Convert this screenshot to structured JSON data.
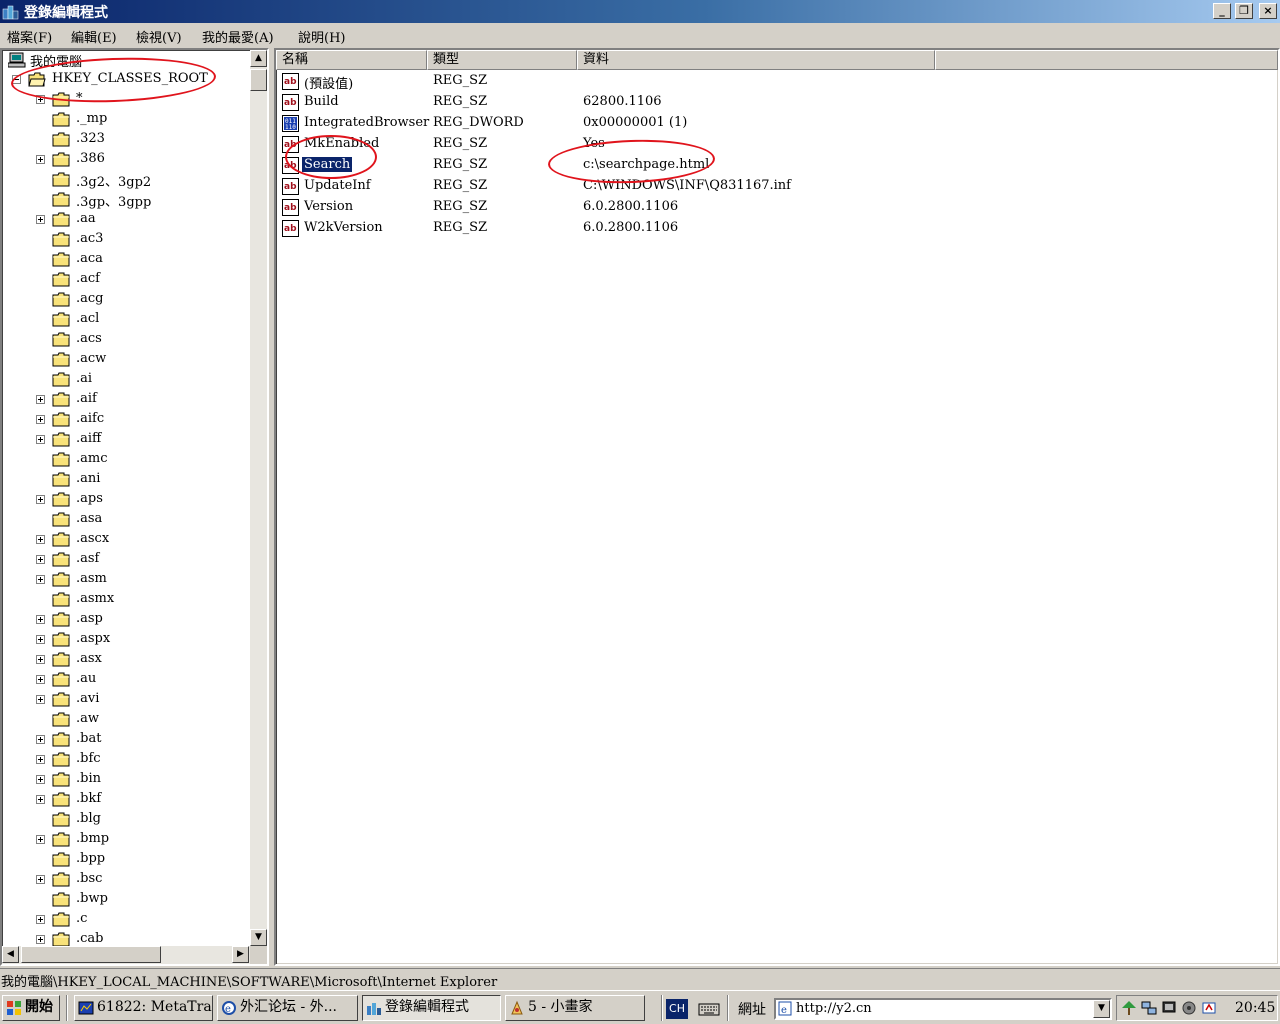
{
  "window": {
    "title": "登錄編輯程式"
  },
  "caption_buttons": {
    "minimize": "_",
    "restore": "❐",
    "close": "×"
  },
  "menu": {
    "file": "檔案(F)",
    "edit": "編輯(E)",
    "view": "檢視(V)",
    "favorites": "我的最愛(A)",
    "help": "說明(H)"
  },
  "tree": {
    "root": "我的電腦",
    "hive": "HKEY_CLASSES_ROOT",
    "items": [
      {
        "label": "*",
        "expander": "plus"
      },
      {
        "label": "._mp",
        "expander": "none"
      },
      {
        "label": ".323",
        "expander": "none"
      },
      {
        "label": ".386",
        "expander": "plus"
      },
      {
        "label": ".3g2、3gp2",
        "expander": "none"
      },
      {
        "label": ".3gp、3gpp",
        "expander": "none"
      },
      {
        "label": ".aa",
        "expander": "plus"
      },
      {
        "label": ".ac3",
        "expander": "none"
      },
      {
        "label": ".aca",
        "expander": "none"
      },
      {
        "label": ".acf",
        "expander": "none"
      },
      {
        "label": ".acg",
        "expander": "none"
      },
      {
        "label": ".acl",
        "expander": "none"
      },
      {
        "label": ".acs",
        "expander": "none"
      },
      {
        "label": ".acw",
        "expander": "none"
      },
      {
        "label": ".ai",
        "expander": "none"
      },
      {
        "label": ".aif",
        "expander": "plus"
      },
      {
        "label": ".aifc",
        "expander": "plus"
      },
      {
        "label": ".aiff",
        "expander": "plus"
      },
      {
        "label": ".amc",
        "expander": "none"
      },
      {
        "label": ".ani",
        "expander": "none"
      },
      {
        "label": ".aps",
        "expander": "plus"
      },
      {
        "label": ".asa",
        "expander": "none"
      },
      {
        "label": ".ascx",
        "expander": "plus"
      },
      {
        "label": ".asf",
        "expander": "plus"
      },
      {
        "label": ".asm",
        "expander": "plus"
      },
      {
        "label": ".asmx",
        "expander": "none"
      },
      {
        "label": ".asp",
        "expander": "plus"
      },
      {
        "label": ".aspx",
        "expander": "plus"
      },
      {
        "label": ".asx",
        "expander": "plus"
      },
      {
        "label": ".au",
        "expander": "plus"
      },
      {
        "label": ".avi",
        "expander": "plus"
      },
      {
        "label": ".aw",
        "expander": "none"
      },
      {
        "label": ".bat",
        "expander": "plus"
      },
      {
        "label": ".bfc",
        "expander": "plus"
      },
      {
        "label": ".bin",
        "expander": "plus"
      },
      {
        "label": ".bkf",
        "expander": "plus"
      },
      {
        "label": ".blg",
        "expander": "none"
      },
      {
        "label": ".bmp",
        "expander": "plus"
      },
      {
        "label": ".bpp",
        "expander": "none"
      },
      {
        "label": ".bsc",
        "expander": "plus"
      },
      {
        "label": ".bwp",
        "expander": "none"
      },
      {
        "label": ".c",
        "expander": "plus"
      },
      {
        "label": ".cab",
        "expander": "plus"
      }
    ]
  },
  "list": {
    "headers": {
      "name": "名稱",
      "type": "類型",
      "data": "資料"
    },
    "rows": [
      {
        "name": "(預設值)",
        "type": "REG_SZ",
        "data": "",
        "icon": "ab-string-icon",
        "selected": false
      },
      {
        "name": "Build",
        "type": "REG_SZ",
        "data": "62800.1106",
        "icon": "ab-string-icon",
        "selected": false
      },
      {
        "name": "IntegratedBrowser",
        "type": "REG_DWORD",
        "data": "0x00000001 (1)",
        "icon": "binary-value-icon",
        "selected": false
      },
      {
        "name": "MkEnabled",
        "type": "REG_SZ",
        "data": "Yes",
        "icon": "ab-string-icon",
        "selected": false
      },
      {
        "name": "Search",
        "type": "REG_SZ",
        "data": "c:\\searchpage.html",
        "icon": "ab-string-icon",
        "selected": true
      },
      {
        "name": "UpdateInf",
        "type": "REG_SZ",
        "data": "C:\\WINDOWS\\INF\\Q831167.inf",
        "icon": "ab-string-icon",
        "selected": false
      },
      {
        "name": "Version",
        "type": "REG_SZ",
        "data": "6.0.2800.1106",
        "icon": "ab-string-icon",
        "selected": false
      },
      {
        "name": "W2kVersion",
        "type": "REG_SZ",
        "data": "6.0.2800.1106",
        "icon": "ab-string-icon",
        "selected": false
      }
    ]
  },
  "status": {
    "path": "我的電腦\\HKEY_LOCAL_MACHINE\\SOFTWARE\\Microsoft\\Internet Explorer"
  },
  "taskbar": {
    "start": "開始",
    "tasks": [
      {
        "label": "61822: MetaTra...",
        "active": false
      },
      {
        "label": "外汇论坛 - 外...",
        "active": false
      },
      {
        "label": "登錄編輯程式",
        "active": true
      },
      {
        "label": "5 - 小畫家",
        "active": false
      }
    ],
    "lang": "CH",
    "address_label": "網址",
    "address_value": "http://y2.cn",
    "clock": "20:45"
  },
  "colors": {
    "selection": "#0a246a",
    "annotation": "#e0141c",
    "title_gradient_start": "#0a246a",
    "title_gradient_end": "#a6caf0"
  }
}
